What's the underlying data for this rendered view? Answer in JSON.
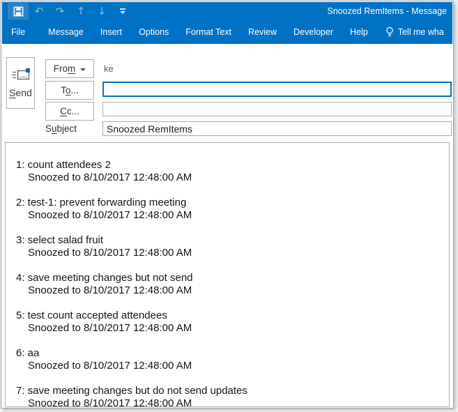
{
  "window": {
    "title": "Snoozed RemItems  -  Message"
  },
  "colors": {
    "titlebar_blue": "#0072C6",
    "focused_field_border": "#0072C6",
    "spellcheck_red": "#D40000",
    "button_border_gray": "#ABABAB"
  },
  "qat": {
    "icons": [
      "save",
      "undo",
      "redo",
      "move-up",
      "move-down",
      "customize-quick-access-toolbar"
    ],
    "undo_glyph": "↶",
    "redo_glyph": "↷",
    "up_glyph": "↑",
    "down_glyph": "↓"
  },
  "ribbon": {
    "tabs": [
      "File",
      "Message",
      "Insert",
      "Options",
      "Format Text",
      "Review",
      "Developer",
      "Help"
    ],
    "tell_me_label": "Tell me wha"
  },
  "compose": {
    "send": {
      "accel": "S",
      "post": "end"
    },
    "from": {
      "pre": "Fro",
      "accel": "m",
      "post": ""
    },
    "from_value": "ke",
    "to": {
      "pre": "T",
      "accel": "o",
      "post": "..."
    },
    "to_value": "",
    "to_focused": true,
    "cc": {
      "pre": "",
      "accel": "C",
      "post": "c..."
    },
    "cc_value": "",
    "subject_label": {
      "pre": "S",
      "accel": "u",
      "post": "bject"
    },
    "subject_value_ok": "Snoozed ",
    "subject_value_misspelled": "RemItems"
  },
  "body": {
    "items": [
      {
        "title": "1: count attendees 2",
        "snooze": "Snoozed to 8/10/2017 12:48:00 AM"
      },
      {
        "title": "2: test-1: prevent forwarding meeting",
        "snooze": "Snoozed to 8/10/2017 12:48:00 AM"
      },
      {
        "title": "3: select salad fruit",
        "snooze": "Snoozed to 8/10/2017 12:48:00 AM"
      },
      {
        "title": "4: save meeting changes but not send",
        "snooze": "Snoozed to 8/10/2017 12:48:00 AM"
      },
      {
        "title": "5: test count accepted attendees",
        "snooze": "Snoozed to 8/10/2017 12:48:00 AM"
      },
      {
        "title": "6: aa",
        "snooze": "Snoozed to 8/10/2017 12:48:00 AM"
      },
      {
        "title": "7: save meeting changes but do not send updates",
        "snooze": "Snoozed to 8/10/2017 12:48:00 AM"
      }
    ]
  }
}
